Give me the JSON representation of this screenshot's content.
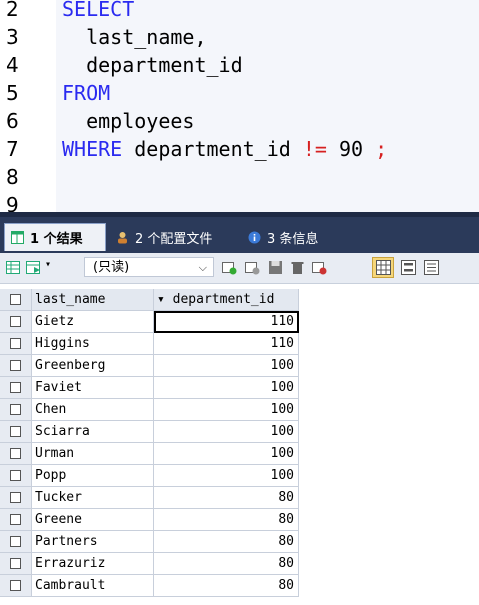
{
  "editor": {
    "line_numbers": [
      "2",
      "3",
      "4",
      "5",
      "6",
      "7",
      "8",
      "9"
    ],
    "lines": [
      [
        {
          "t": "SELECT",
          "c": "kw"
        }
      ],
      [
        {
          "t": "  last_name,",
          "c": "plain"
        }
      ],
      [
        {
          "t": "  department_id",
          "c": "plain"
        }
      ],
      [
        {
          "t": "FROM",
          "c": "kw"
        }
      ],
      [
        {
          "t": "  employees",
          "c": "plain"
        }
      ],
      [
        {
          "t": "WHERE",
          "c": "kw"
        },
        {
          "t": " department_id ",
          "c": "plain"
        },
        {
          "t": "!=",
          "c": "op"
        },
        {
          "t": " 90 ",
          "c": "num"
        },
        {
          "t": ";",
          "c": "op"
        }
      ],
      [],
      []
    ]
  },
  "tabs": [
    {
      "label": "1 个结果",
      "icon": "result-grid-icon"
    },
    {
      "label": "2 个配置文件",
      "icon": "profile-icon"
    },
    {
      "label": "3 条信息",
      "icon": "info-icon"
    }
  ],
  "toolbar": {
    "mode_select": "(只读)"
  },
  "grid": {
    "columns": [
      "last_name",
      "▾ department_id"
    ],
    "rows": [
      [
        "Gietz",
        "110"
      ],
      [
        "Higgins",
        "110"
      ],
      [
        "Greenberg",
        "100"
      ],
      [
        "Faviet",
        "100"
      ],
      [
        "Chen",
        "100"
      ],
      [
        "Sciarra",
        "100"
      ],
      [
        "Urman",
        "100"
      ],
      [
        "Popp",
        "100"
      ],
      [
        "Tucker",
        "80"
      ],
      [
        "Greene",
        "80"
      ],
      [
        "Partners",
        "80"
      ],
      [
        "Errazuriz",
        "80"
      ],
      [
        "Cambrault",
        "80"
      ]
    ]
  },
  "colors": {
    "keyword": "#2a2af0",
    "operator": "#d62020",
    "tabbar": "#2b3a5a"
  }
}
